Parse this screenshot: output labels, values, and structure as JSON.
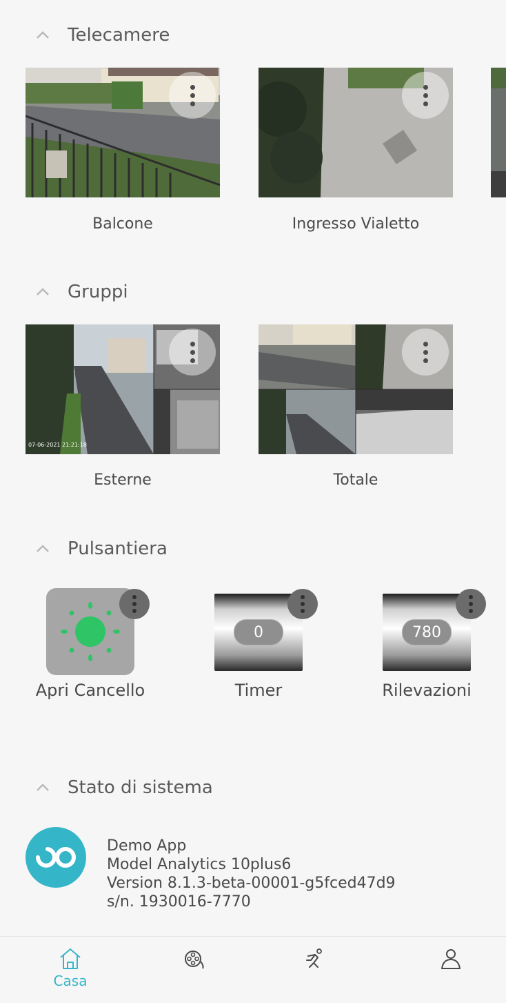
{
  "sections": {
    "cameras": {
      "title": "Telecamere",
      "items": [
        {
          "label": "Balcone"
        },
        {
          "label": "Ingresso Vialetto"
        }
      ]
    },
    "groups": {
      "title": "Gruppi",
      "items": [
        {
          "label": "Esterne",
          "overlay_text": "07-06-2021 21:21:18"
        },
        {
          "label": "Totale"
        }
      ]
    },
    "buttons": {
      "title": "Pulsantiera",
      "items": [
        {
          "label": "Apri Cancello",
          "icon": "sun-icon"
        },
        {
          "label": "Timer",
          "value": "0"
        },
        {
          "label": "Rilevazioni",
          "value": "780"
        }
      ]
    },
    "system": {
      "title": "Stato di sistema",
      "name": "Demo App",
      "model": "Model Analytics 10plus6",
      "version": "Version 8.1.3-beta-00001-g5fced47d9",
      "serial": "s/n. 1930016-7770"
    }
  },
  "bottom_nav": {
    "items": [
      {
        "label": "Casa",
        "icon": "home-icon",
        "active": true
      },
      {
        "label": "",
        "icon": "film-reel-icon"
      },
      {
        "label": "",
        "icon": "running-person-icon"
      },
      {
        "label": "",
        "icon": "user-icon"
      }
    ]
  },
  "colors": {
    "accent": "#35b6c8",
    "sun": "#2fc466",
    "background": "#f6f6f6"
  }
}
